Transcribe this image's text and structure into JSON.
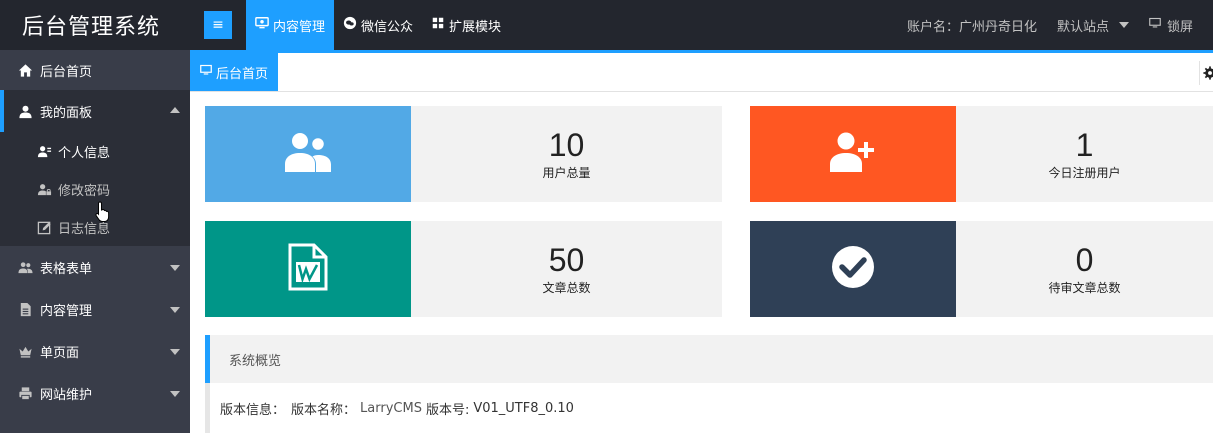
{
  "header": {
    "logo": "后台管理系统",
    "menu_toggle": "≡",
    "nav": [
      {
        "label": "内容管理",
        "icon": "monitor-icon",
        "active": true
      },
      {
        "label": "微信公众",
        "icon": "wechat-icon",
        "active": false
      },
      {
        "label": "扩展模块",
        "icon": "grid-icon",
        "active": false
      }
    ],
    "account": "账户名：广州丹奇日化",
    "site": "默认站点",
    "lock": "锁屏"
  },
  "sidebar": {
    "home": "后台首页",
    "my_panel": "我的面板",
    "sub_items": [
      "个人信息",
      "修改密码",
      "日志信息"
    ],
    "groups": [
      "表格表单",
      "内容管理",
      "单页面",
      "网站维护"
    ]
  },
  "tab": {
    "label": "后台首页"
  },
  "stats": [
    {
      "value": "10",
      "label": "用户总量",
      "color": "#52a9e6",
      "icon": "users-icon"
    },
    {
      "value": "1",
      "label": "今日注册用户",
      "color": "#ff5722",
      "icon": "user-plus-icon"
    },
    {
      "value": "50",
      "label": "文章总数",
      "color": "#009688",
      "icon": "word-doc-icon"
    },
    {
      "value": "0",
      "label": "待审文章总数",
      "color": "#2f4056",
      "icon": "check-circle-icon"
    }
  ],
  "overview": {
    "title": "系统概览",
    "version_label": "版本信息：",
    "name_label": "版本名称：",
    "name_value": "LarryCMS",
    "number_label": "版本号:",
    "number_value": "V01_UTF8_0.10"
  }
}
